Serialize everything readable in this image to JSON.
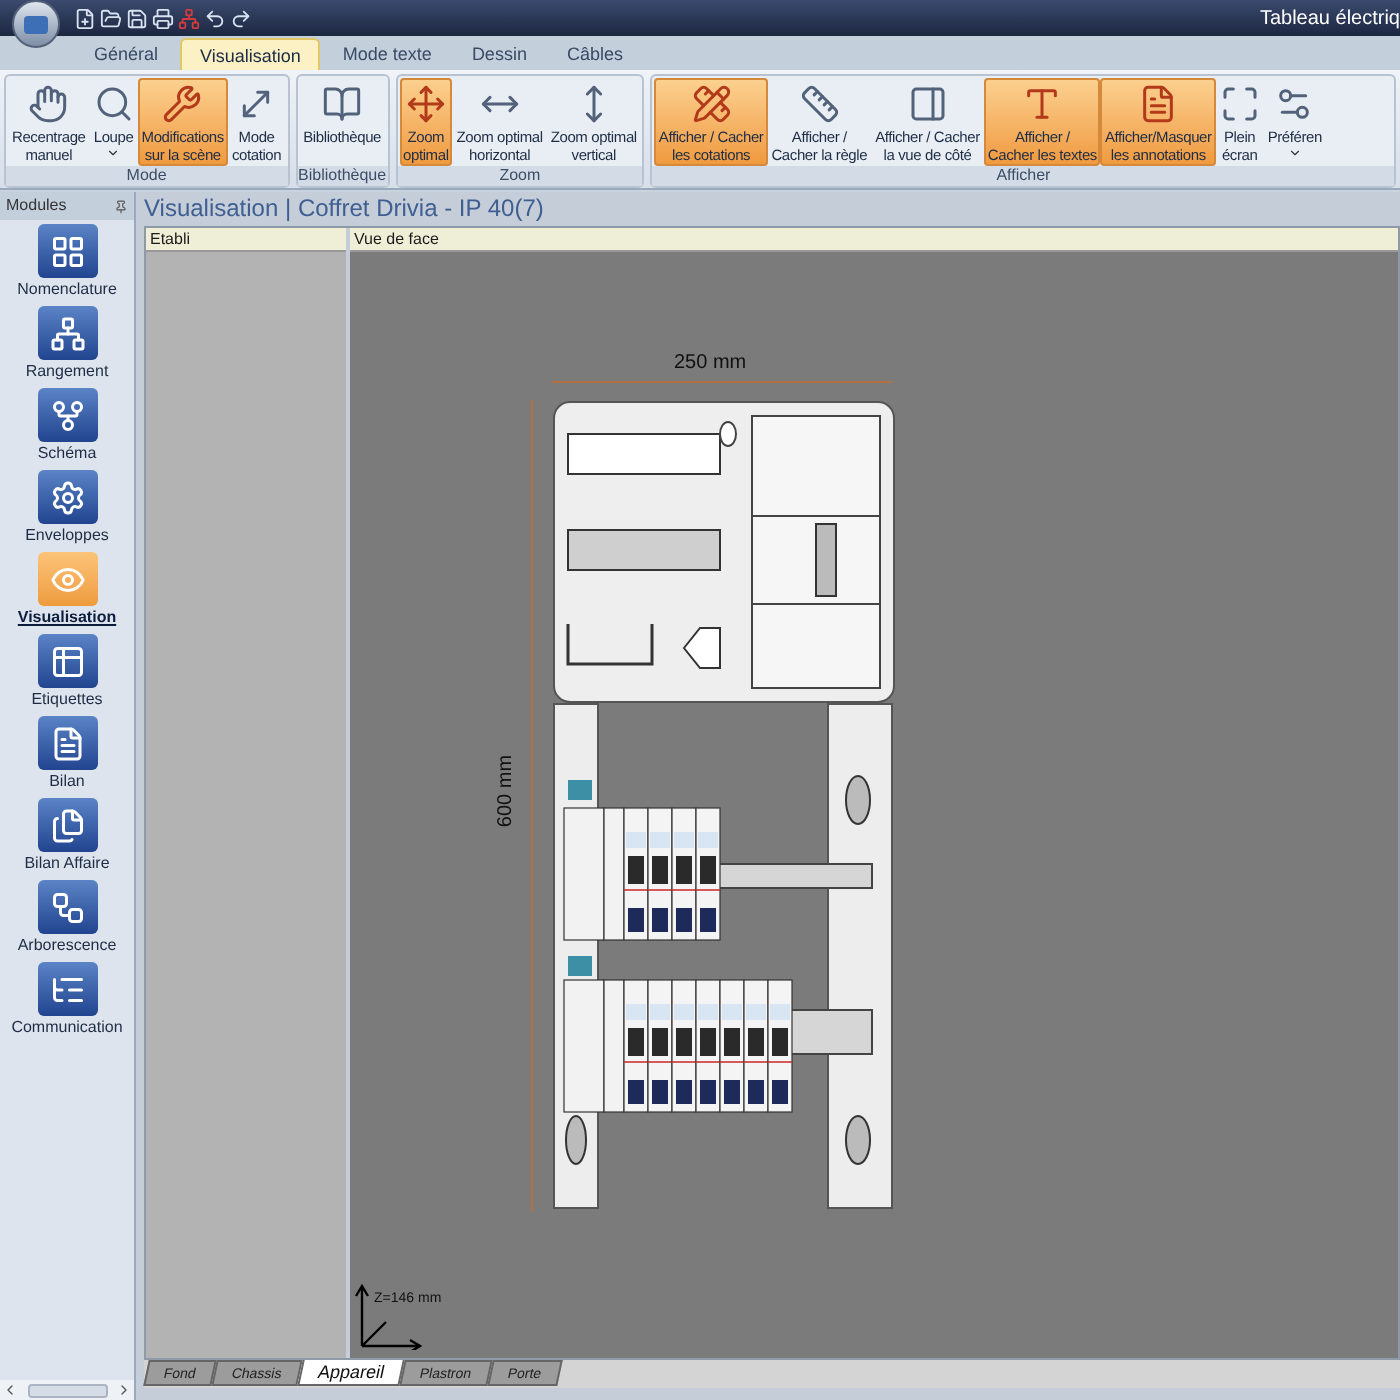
{
  "title_bar": {
    "title": "Tableau électriq"
  },
  "tabs": [
    {
      "label": "Général",
      "selected": false
    },
    {
      "label": "Visualisation",
      "selected": true
    },
    {
      "label": "Mode texte",
      "selected": false
    },
    {
      "label": "Dessin",
      "selected": false
    },
    {
      "label": "Câbles",
      "selected": false
    }
  ],
  "ribbon": {
    "groups": [
      {
        "label": "Mode",
        "buttons": [
          {
            "label": "Recentrage\nmanuel",
            "selected": false,
            "dropdown": false
          },
          {
            "label": "Loupe",
            "selected": false,
            "dropdown": true
          },
          {
            "label": "Modifications\nsur la scène",
            "selected": true,
            "dropdown": false
          },
          {
            "label": "Mode\ncotation",
            "selected": false,
            "dropdown": false
          }
        ]
      },
      {
        "label": "Bibliothèque",
        "buttons": [
          {
            "label": "Bibliothèque",
            "selected": false,
            "dropdown": false
          }
        ]
      },
      {
        "label": "Zoom",
        "buttons": [
          {
            "label": "Zoom\noptimal",
            "selected": true,
            "dropdown": false
          },
          {
            "label": "Zoom optimal\nhorizontal",
            "selected": false,
            "dropdown": false
          },
          {
            "label": "Zoom optimal\nvertical",
            "selected": false,
            "dropdown": false
          }
        ]
      },
      {
        "label": "Afficher",
        "buttons": [
          {
            "label": "Afficher / Cacher\nles cotations",
            "selected": true,
            "dropdown": false
          },
          {
            "label": "Afficher /\nCacher la règle",
            "selected": false,
            "dropdown": false
          },
          {
            "label": "Afficher / Cacher\nla vue de côté",
            "selected": false,
            "dropdown": false
          },
          {
            "label": "Afficher /\nCacher les textes",
            "selected": true,
            "dropdown": false
          },
          {
            "label": "Afficher/Masquer\nles annotations",
            "selected": true,
            "dropdown": false
          },
          {
            "label": "Plein\nécran",
            "selected": false,
            "dropdown": false
          },
          {
            "label": "Préféren",
            "selected": false,
            "dropdown": true
          }
        ]
      }
    ]
  },
  "modules": {
    "title": "Modules",
    "items": [
      {
        "label": "Nomenclature",
        "selected": false
      },
      {
        "label": "Rangement",
        "selected": false
      },
      {
        "label": "Schéma",
        "selected": false
      },
      {
        "label": "Enveloppes",
        "selected": false
      },
      {
        "label": "Visualisation",
        "selected": true
      },
      {
        "label": "Etiquettes",
        "selected": false
      },
      {
        "label": "Bilan",
        "selected": false
      },
      {
        "label": "Bilan Affaire",
        "selected": false
      },
      {
        "label": "Arborescence",
        "selected": false
      },
      {
        "label": "Communication",
        "selected": false
      }
    ]
  },
  "document": {
    "title": "Visualisation | Coffret Drivia - IP 40(7)",
    "columns": [
      "Etabli",
      "Vue de face"
    ],
    "canvas": {
      "width_label": "250 mm",
      "height_label": "600 mm",
      "axis_label": "Z=146 mm"
    },
    "bottom_tabs": [
      {
        "label": "Fond",
        "selected": false
      },
      {
        "label": "Chassis",
        "selected": false
      },
      {
        "label": "Appareil",
        "selected": true
      },
      {
        "label": "Plastron",
        "selected": false
      },
      {
        "label": "Porte",
        "selected": false
      }
    ]
  }
}
